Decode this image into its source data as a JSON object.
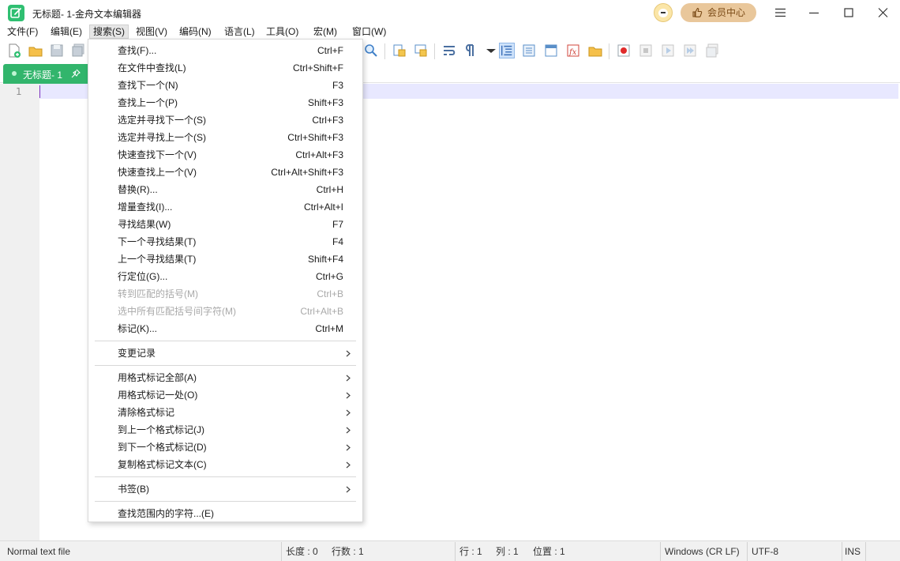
{
  "window": {
    "title": "无标题- 1-金舟文本编辑器",
    "vip_label": "会员中心"
  },
  "menubar": [
    "文件(F)",
    "编辑(E)",
    "搜索(S)",
    "视图(V)",
    "编码(N)",
    "语言(L)",
    "工具(O)",
    "宏(M)",
    "窗口(W)"
  ],
  "active_menu": "搜索(S)",
  "tab": {
    "label": "无标题- 1",
    "close": "×"
  },
  "editor": {
    "line_number": "1"
  },
  "search_menu": {
    "items": [
      {
        "label": "查找(F)...",
        "shortcut": "Ctrl+F"
      },
      {
        "label": "在文件中查找(L)",
        "shortcut": "Ctrl+Shift+F"
      },
      {
        "label": "查找下一个(N)",
        "shortcut": "F3"
      },
      {
        "label": "查找上一个(P)",
        "shortcut": "Shift+F3"
      },
      {
        "label": "选定并寻找下一个(S)",
        "shortcut": "Ctrl+F3"
      },
      {
        "label": "选定并寻找上一个(S)",
        "shortcut": "Ctrl+Shift+F3"
      },
      {
        "label": "快速查找下一个(V)",
        "shortcut": "Ctrl+Alt+F3"
      },
      {
        "label": "快速查找上一个(V)",
        "shortcut": "Ctrl+Alt+Shift+F3"
      },
      {
        "label": "替换(R)...",
        "shortcut": "Ctrl+H"
      },
      {
        "label": "增量查找(I)...",
        "shortcut": "Ctrl+Alt+I"
      },
      {
        "label": "寻找结果(W)",
        "shortcut": "F7"
      },
      {
        "label": "下一个寻找结果(T)",
        "shortcut": "F4"
      },
      {
        "label": "上一个寻找结果(T)",
        "shortcut": "Shift+F4"
      },
      {
        "label": "行定位(G)...",
        "shortcut": "Ctrl+G"
      },
      {
        "label": "转到匹配的括号(M)",
        "shortcut": "Ctrl+B",
        "disabled": true
      },
      {
        "label": "选中所有匹配括号间字符(M)",
        "shortcut": "Ctrl+Alt+B",
        "disabled": true
      },
      {
        "label": "标记(K)...",
        "shortcut": "Ctrl+M"
      }
    ],
    "group2": [
      {
        "label": "变更记录"
      }
    ],
    "group3": [
      {
        "label": "用格式标记全部(A)"
      },
      {
        "label": "用格式标记一处(O)"
      },
      {
        "label": "清除格式标记"
      },
      {
        "label": "到上一个格式标记(J)"
      },
      {
        "label": "到下一个格式标记(D)"
      },
      {
        "label": "复制格式标记文本(C)"
      }
    ],
    "group4": [
      {
        "label": "书签(B)"
      }
    ],
    "group5": [
      {
        "label": "查找范围内的字符...(E)"
      }
    ]
  },
  "statusbar": {
    "file_type": "Normal text file",
    "length": "长度 : 0",
    "lines": "行数 : 1",
    "row": "行 : 1",
    "col": "列 : 1",
    "position": "位置 : 1",
    "eol": "Windows (CR LF)",
    "encoding": "UTF-8",
    "mode": "INS"
  },
  "colors": {
    "tab_active": "#32b56c",
    "vip_button": "#e9c79b",
    "current_line": "#e8e8ff",
    "gutter": "#f0f0f0"
  },
  "icons": [
    "app-logo-icon",
    "mascot-icon",
    "thumb-up-icon",
    "hamburger-menu-icon",
    "minimize-icon",
    "maximize-icon",
    "close-icon",
    "pin-icon",
    "chevron-right-icon"
  ]
}
